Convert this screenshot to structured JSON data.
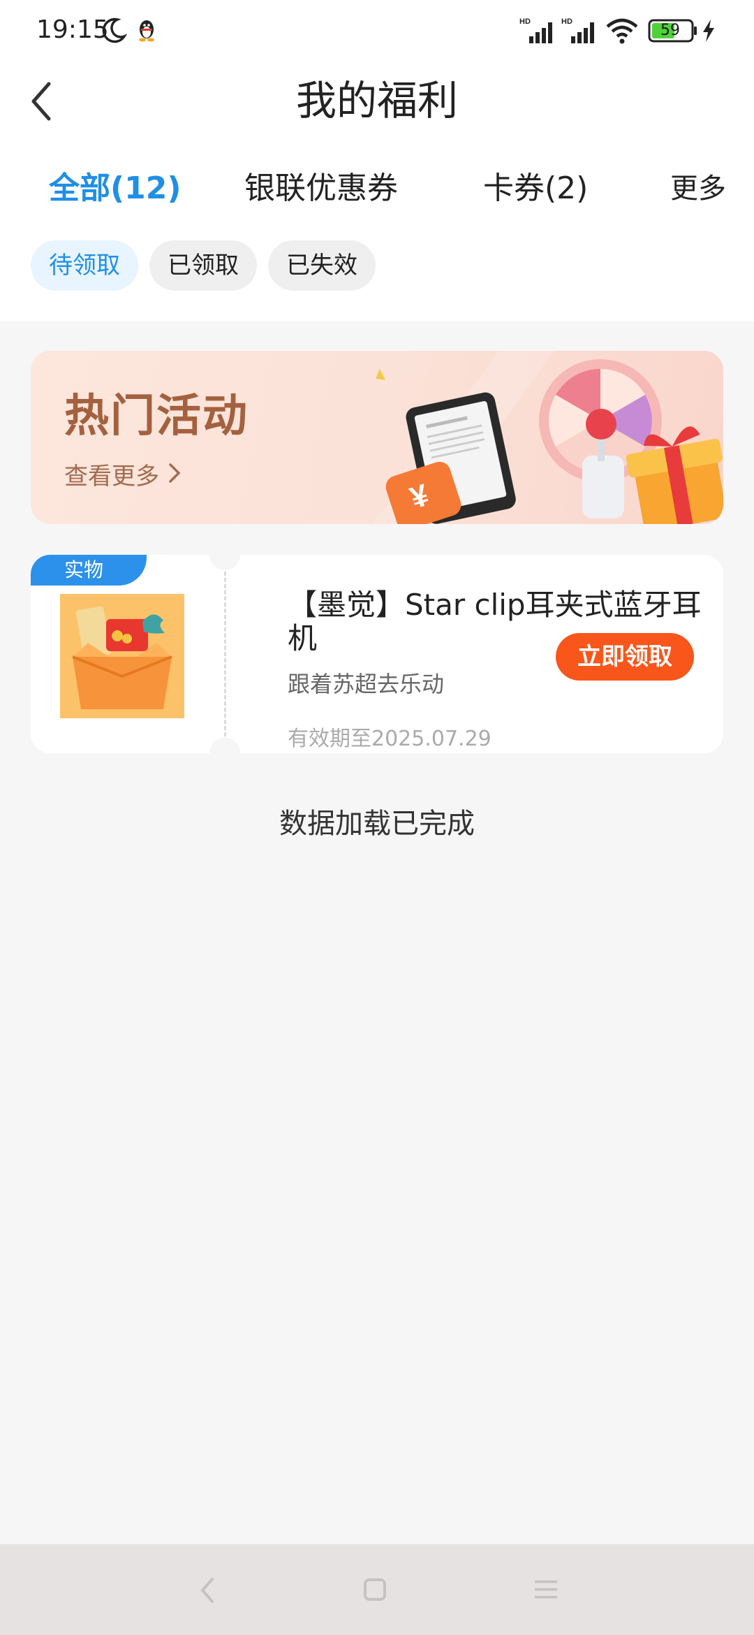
{
  "status_bar": {
    "time": "19:15",
    "battery_level": "59",
    "icons": [
      "moon-icon",
      "qq-penguin-icon",
      "hd-signal-icon",
      "hd-signal-icon",
      "wifi-icon",
      "battery-icon",
      "charging-icon"
    ]
  },
  "header": {
    "title": "我的福利",
    "back_icon": "chevron-left-icon"
  },
  "tabs": [
    {
      "label": "全部(12)",
      "active": true
    },
    {
      "label": "银联优惠券",
      "active": false
    },
    {
      "label": "卡券(2)",
      "active": false
    },
    {
      "label": "更多",
      "active": false
    }
  ],
  "filters": [
    {
      "label": "待领取",
      "active": true
    },
    {
      "label": "已领取",
      "active": false
    },
    {
      "label": "已失效",
      "active": false
    }
  ],
  "banner": {
    "title": "热门活动",
    "more_label": "查看更多"
  },
  "coupon": {
    "type_badge": "实物",
    "name": "【墨觉】Star clip耳夹式蓝牙耳机",
    "subtitle": "跟着苏超去乐动",
    "expiry": "有效期至2025.07.29",
    "claim_label": "立即领取"
  },
  "load_status": "数据加载已完成",
  "colors": {
    "accent_blue": "#1f8fe6",
    "claim_orange": "#f8561b",
    "banner_text": "#a4613f"
  }
}
